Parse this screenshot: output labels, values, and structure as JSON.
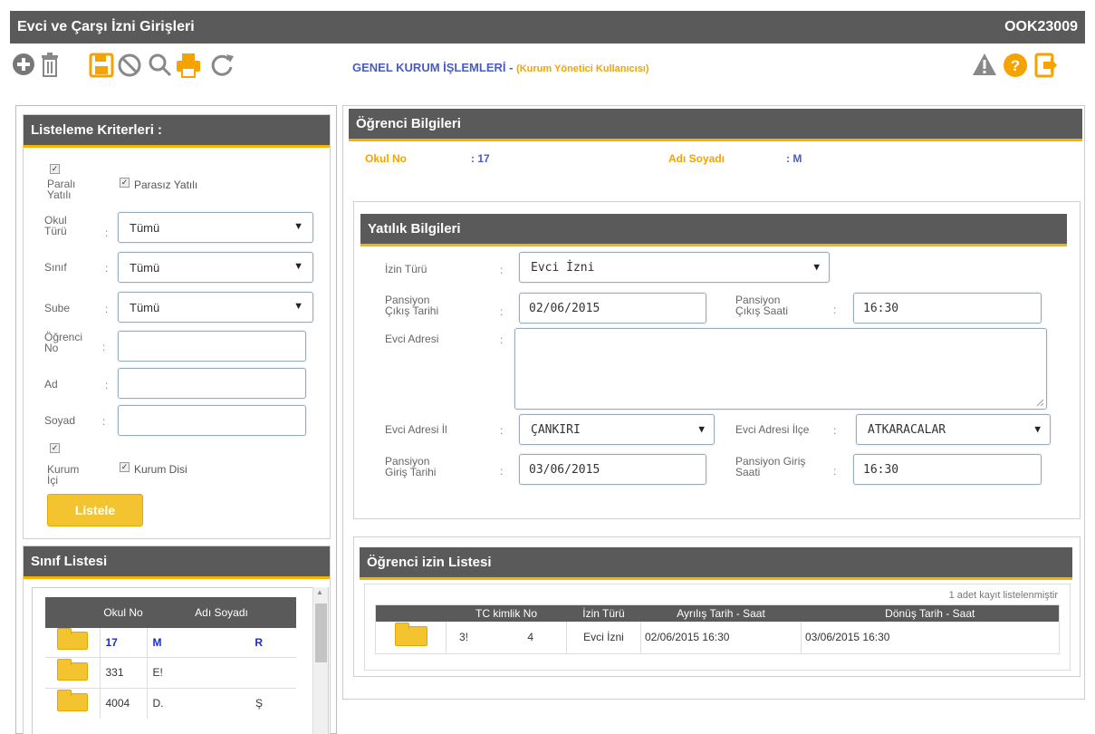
{
  "header": {
    "title": "Evci ve Çarşı İzni Girişleri",
    "code": "OOK23009"
  },
  "toolbar": {
    "breadcrumb": "GENEL KURUM İŞLEMLERİ -",
    "role": "(Kurum Yönetici Kullanıcısı)",
    "icons": [
      "add-icon",
      "delete-icon",
      "save-icon",
      "cancel-icon",
      "search-icon",
      "print-icon",
      "refresh-icon",
      "warning-icon",
      "help-icon",
      "exit-icon"
    ]
  },
  "criteria": {
    "title": "Listeleme Kriterleri :",
    "parali_yatili": "Paralı Yatılı",
    "parasiz_yatili": "Parasız Yatılı",
    "okul_turu_label": "Okul Türü",
    "okul_turu_value": "Tümü",
    "sinif_label": "Sınıf",
    "sinif_value": "Tümü",
    "sube_label": "Sube",
    "sube_value": "Tümü",
    "ogrenci_no_label": "Öğrenci No",
    "ad_label": "Ad",
    "soyad_label": "Soyad",
    "kurum_ici": "Kurum İçi",
    "kurum_disi": "Kurum Disi",
    "listele": "Listele"
  },
  "class_list": {
    "title": "Sınıf Listesi",
    "col_no": "Okul No",
    "col_name": "Adı Soyadı",
    "rows": [
      {
        "no": "17",
        "name": "M",
        "surname": "R"
      },
      {
        "no": "331",
        "name": "E!",
        "surname": ""
      },
      {
        "no": "4004",
        "name": "D.",
        "surname": "Ş"
      }
    ]
  },
  "student": {
    "title": "Öğrenci Bilgileri",
    "okul_no_label": "Okul No",
    "okul_no": ": 17",
    "adi_label": "Adı Soyadı",
    "adi": ": M"
  },
  "yatilik": {
    "title": "Yatılık Bilgileri",
    "izin_turu_label": "İzin Türü",
    "izin_turu": "Evci İzni",
    "cikis_tarihi_label": "Pansiyon Çıkış Tarihi",
    "cikis_tarihi": "02/06/2015",
    "cikis_saati_label": "Pansiyon Çıkış Saati",
    "cikis_saati": "16:30",
    "evci_adresi_label": "Evci Adresi",
    "il_label": "Evci Adresi İl",
    "il": "ÇANKIRI",
    "ilce_label": "Evci Adresi İlçe",
    "ilce": "ATKARACALAR",
    "giris_tarihi_label": "Pansiyon Giriş Tarihi",
    "giris_tarihi": "03/06/2015",
    "giris_saati_label": "Pansiyon Giriş Saati",
    "giris_saati": "16:30"
  },
  "izin_list": {
    "title": "Öğrenci izin Listesi",
    "count": "1 adet kayıt listelenmiştir",
    "cols": [
      "TC kimlik No",
      "İzin Türü",
      "Ayrılış Tarih - Saat",
      "Dönüş Tarih - Saat"
    ],
    "row": {
      "tc_a": "3!",
      "tc_b": "4",
      "izin": "Evci İzni",
      "ayrilis": "02/06/2015 16:30",
      "donus": "03/06/2015 16:30"
    }
  },
  "colors": {
    "accent": "#f4b400",
    "header": "#5a5a5a",
    "link": "#4a5cbf",
    "orange": "#f4a300"
  }
}
